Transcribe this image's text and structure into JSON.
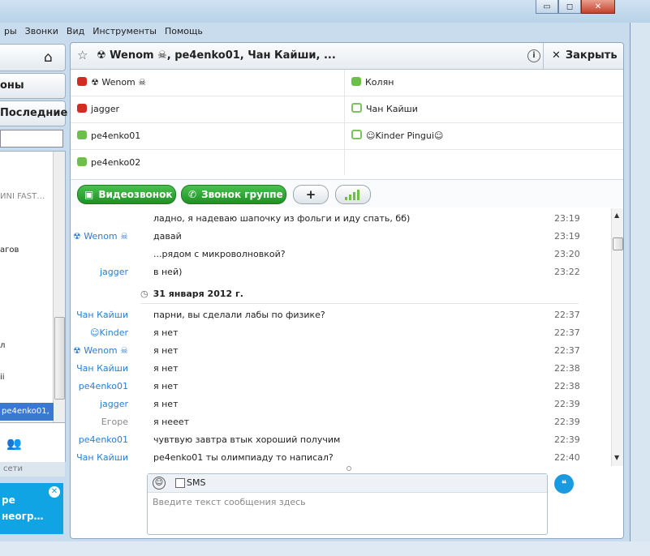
{
  "menu": {
    "items": [
      "ры",
      "Звонки",
      "Вид",
      "Инструменты",
      "Помощь"
    ]
  },
  "left": {
    "btn_contacts": "оны",
    "btn_recent": "Последние",
    "items": [
      "ИNI FAST…",
      "агов",
      "л",
      "іі"
    ],
    "selected": "pe4enko01, …",
    "add_contact_icon": "add-contact-icon",
    "network_label": "сети",
    "promo_lines": [
      "ре",
      "неогр…"
    ]
  },
  "conversation": {
    "title": "☢ Wenom ☠, pe4enko01, Чан Кайши, ...",
    "close_label": "Закрыть",
    "participants_left": [
      {
        "name": "☢ Wenom ☠",
        "status": "busy"
      },
      {
        "name": "jagger",
        "status": "busy"
      },
      {
        "name": "pe4enko01",
        "status": "online"
      },
      {
        "name": "pe4enko02",
        "status": "online"
      }
    ],
    "participants_right": [
      {
        "name": "Колян",
        "status": "online"
      },
      {
        "name": "Чан Кайши",
        "status": "offline"
      },
      {
        "name": "☺Kinder Pingui☺",
        "status": "offline"
      }
    ]
  },
  "actions": {
    "video_call": "Видеозвонок",
    "group_call": "Звонок группе",
    "add": "+"
  },
  "chat": {
    "date_label": "31 января 2012 г.",
    "messages_before": [
      {
        "author": "",
        "text": "ладно, я надеваю шапочку из фольги и иду спать, бб)",
        "time": "23:19"
      },
      {
        "author": "☢ Wenom ☠",
        "text": "давай",
        "time": "23:19"
      },
      {
        "author": "",
        "text": "...рядом с микроволновкой?",
        "time": "23:20"
      },
      {
        "author": "jagger",
        "text": "в ней)",
        "time": "23:22"
      }
    ],
    "messages_after": [
      {
        "author": "Чан Кайши",
        "text": "парни, вы сделали лабы по физике?",
        "time": "22:37"
      },
      {
        "author": "☺Kinder",
        "text": "я нет",
        "time": "22:37"
      },
      {
        "author": "☢ Wenom ☠",
        "text": "я нет",
        "time": "22:37"
      },
      {
        "author": "Чан Кайши",
        "text": "я нет",
        "time": "22:38"
      },
      {
        "author": "pe4enko01",
        "text": "я нет",
        "time": "22:38"
      },
      {
        "author": "jagger",
        "text": "я нет",
        "time": "22:39"
      },
      {
        "author": "Егоре",
        "text": "я нееет",
        "time": "22:39"
      },
      {
        "author": "pe4enko01",
        "text": "чувтвую завтра втык хороший получим",
        "time": "22:39"
      },
      {
        "author": "Чан Кайши",
        "text": "pe4enko01 ты олимпиаду то написал?",
        "time": "22:40"
      }
    ]
  },
  "composer": {
    "sms_label": "SMS",
    "placeholder": "Введите текст сообщения здесь"
  },
  "colors": {
    "accent": "#1f8f26",
    "link": "#2b7cd3",
    "busy": "#d32b1f",
    "online": "#6cc04a",
    "promo": "#10a4e4"
  }
}
